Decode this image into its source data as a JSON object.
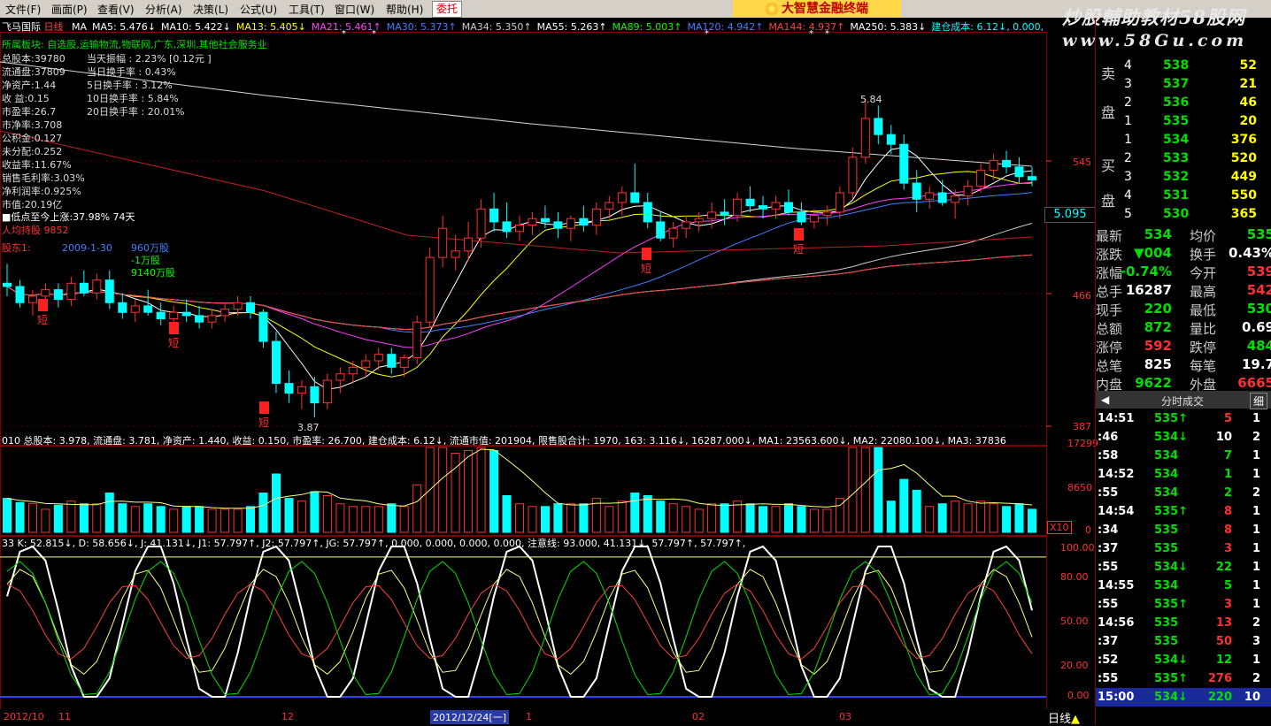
{
  "menu": [
    "文件(F)",
    "画面(P)",
    "查看(V)",
    "分析(A)",
    "决策(L)",
    "公式(U)",
    "工具(T)",
    "窗口(W)",
    "帮助(H)"
  ],
  "trade_button": "委托",
  "banner": "大智慧金融终端",
  "watermark": {
    "line1": "炒股輔助教材58股网",
    "line2": "www.58Gu.com"
  },
  "header": {
    "stock": "飞马国际",
    "period": "日线",
    "ma_items": [
      {
        "label": "MA",
        "color": "#ffffff"
      },
      {
        "label": "MA5: 5.476↓",
        "color": "#ffffff"
      },
      {
        "label": "MA10: 5.422↓",
        "color": "#ffffff"
      },
      {
        "label": "MA13: 5.405↓",
        "color": "#ffff00"
      },
      {
        "label": "MA21: 5.461↑",
        "color": "#ff40ff"
      },
      {
        "label": "MA30: 5.373↑",
        "color": "#4080ff"
      },
      {
        "label": "MA34: 5.350↑",
        "color": "#cccccc"
      },
      {
        "label": "MA55: 5.263↑",
        "color": "#ffffff"
      },
      {
        "label": "MA89: 5.003↑",
        "color": "#00ff00"
      },
      {
        "label": "MA120: 4.942↑",
        "color": "#4080ff"
      },
      {
        "label": "MA144: 4.937↑",
        "color": "#ff4040"
      },
      {
        "label": "MA250: 5.383↓",
        "color": "#ffffff"
      },
      {
        "label": "建仓成本: 6.12↓, 0.000, 0.00",
        "color": "#00ffff"
      }
    ]
  },
  "sector": "所属板块: 自选股,运输物流,物联网,广东,深圳,其他社会服务业",
  "fundamentals": [
    {
      "label": "总股本:",
      "value": "39780"
    },
    {
      "label": "流通盘:",
      "value": "37809"
    },
    {
      "label": "净资产:",
      "value": "1.44"
    },
    {
      "label": "收  益:",
      "value": "0.15"
    },
    {
      "label": "市盈率:",
      "value": "26.7"
    },
    {
      "label": "市净率:",
      "value": "3.708"
    },
    {
      "label": "公积金:",
      "value": "0.127"
    },
    {
      "label": "未分配:",
      "value": "0.252"
    },
    {
      "label": "收益率:",
      "value": "11.67%"
    },
    {
      "label": "销售毛利率:",
      "value": "3.03%"
    },
    {
      "label": "净利润率",
      "value": ":0.925%"
    },
    {
      "label": "市值:",
      "value": "20.19亿"
    }
  ],
  "turnover": [
    "当天振幅   : 2.23% [0.12元 ]",
    "当日换手率 : 0.43%",
    "5日换手率  : 3.12%",
    "10日换手率 : 5.84%",
    "20日换手率 : 20.01%"
  ],
  "low_to_now": "■低点至今上涨:37.98%   74天",
  "holder_text": "人均持股 9852",
  "holders": [
    {
      "date": "2009-1-30",
      "shares": "960万股",
      "color": "#4080ff"
    },
    {
      "date": "",
      "shares": "-1万股",
      "color": "#00ff00"
    },
    {
      "date": "",
      "shares": "9140万股",
      "color": "#00ff00"
    }
  ],
  "holders_tag": "股东1:",
  "price_axis": [
    "545",
    "466",
    "387"
  ],
  "current_price_tag": "5.095",
  "high_label": "5.84",
  "low_label": "3.87",
  "vol_header": "010 总股本: 3.978, 流通盘: 3.781, 净资产: 1.440, 收益: 0.150, 市盈率: 26.700, 建仓成本: 6.12↓, 流通市值: 201904, 限售股合计: 1970, 163: 3.116↓, 16287.000↓, MA1: 23563.600↓, MA2: 22080.100↓, MA3: 37836",
  "vol_axis": [
    "17299",
    "8650",
    "0"
  ],
  "vol_unit": "X10",
  "kdj_header": "33 K: 52.815↓, D: 58.656↓, J: 41.131↓, J1: 57.797↑, J2: 57.797↑, JG: 57.797↑, 0.000, 0.000, 0.000, 0.000, 注意线: 93.000, 41.131↓, 57.797↑, 57.797↑,",
  "kdj_axis": [
    "100.00",
    "80.00",
    "50.00",
    "20.00",
    "0.00"
  ],
  "date_axis": [
    "2012/10",
    "11",
    "12",
    "2012/12/24[一]",
    "1",
    "02",
    "03"
  ],
  "bottom_tag": "日线",
  "signal_labels": [
    "短",
    "短",
    "短",
    "短",
    "短"
  ],
  "order_book": {
    "sell": [
      {
        "n": "4",
        "price": "538",
        "vol": "52"
      },
      {
        "n": "3",
        "price": "537",
        "vol": "21"
      },
      {
        "n": "2",
        "price": "536",
        "vol": "46"
      },
      {
        "n": "1",
        "price": "535",
        "vol": "20"
      }
    ],
    "buy": [
      {
        "n": "1",
        "price": "534",
        "vol": "376"
      },
      {
        "n": "2",
        "price": "533",
        "vol": "520"
      },
      {
        "n": "3",
        "price": "532",
        "vol": "449"
      },
      {
        "n": "4",
        "price": "531",
        "vol": "550"
      },
      {
        "n": "5",
        "price": "530",
        "vol": "365"
      }
    ],
    "sell_label": [
      "卖",
      "盘"
    ],
    "buy_label": [
      "买",
      "盘"
    ]
  },
  "quote": [
    {
      "l1": "最新",
      "v1": "534",
      "c1": "#00e000",
      "l2": "均价",
      "v2": "535",
      "c2": "#00e000"
    },
    {
      "l1": "涨跌",
      "v1": "▼004",
      "c1": "#00e000",
      "l2": "换手",
      "v2": "0.43%",
      "c2": "#ffffff"
    },
    {
      "l1": "涨幅",
      "v1": "-0.74%",
      "c1": "#00e000",
      "l2": "今开",
      "v2": "539",
      "c2": "#ff3030"
    },
    {
      "l1": "总手",
      "v1": "16287",
      "c1": "#ffffff",
      "l2": "最高",
      "v2": "542",
      "c2": "#ff3030"
    },
    {
      "l1": "现手",
      "v1": "220",
      "c1": "#00e000",
      "l2": "最低",
      "v2": "530",
      "c2": "#00e000"
    },
    {
      "l1": "总额",
      "v1": "872",
      "c1": "#00e000",
      "l2": "量比",
      "v2": "0.69",
      "c2": "#ffffff"
    },
    {
      "l1": "涨停",
      "v1": "592",
      "c1": "#ff3030",
      "l2": "跌停",
      "v2": "484",
      "c2": "#00e000"
    },
    {
      "l1": "总笔",
      "v1": "825",
      "c1": "#ffffff",
      "l2": "每笔",
      "v2": "19.7",
      "c2": "#ffffff"
    },
    {
      "l1": "内盘",
      "v1": "9622",
      "c1": "#00e000",
      "l2": "外盘",
      "v2": "6665",
      "c2": "#ff3030"
    }
  ],
  "tick_header": {
    "title": "分时成交",
    "left": "◀",
    "right": "细"
  },
  "ticks": [
    {
      "t": "14:51",
      "p": "535↑",
      "pc": "#00e000",
      "v": "5",
      "vc": "#ff3030",
      "n": "1"
    },
    {
      "t": ":46",
      "p": "534↓",
      "pc": "#00e000",
      "v": "10",
      "vc": "#ffffff",
      "n": "2"
    },
    {
      "t": ":58",
      "p": "534",
      "pc": "#00e000",
      "v": "7",
      "vc": "#00e000",
      "n": "1"
    },
    {
      "t": "14:52",
      "p": "534",
      "pc": "#00e000",
      "v": "1",
      "vc": "#00e000",
      "n": "1"
    },
    {
      "t": ":55",
      "p": "534",
      "pc": "#00e000",
      "v": "2",
      "vc": "#00e000",
      "n": "2"
    },
    {
      "t": "14:54",
      "p": "535↑",
      "pc": "#00e000",
      "v": "8",
      "vc": "#ff3030",
      "n": "1"
    },
    {
      "t": ":34",
      "p": "535",
      "pc": "#00e000",
      "v": "8",
      "vc": "#ff3030",
      "n": "1"
    },
    {
      "t": ":37",
      "p": "535",
      "pc": "#00e000",
      "v": "3",
      "vc": "#ff3030",
      "n": "1"
    },
    {
      "t": ":55",
      "p": "534↓",
      "pc": "#00e000",
      "v": "22",
      "vc": "#00e000",
      "n": "1"
    },
    {
      "t": "14:55",
      "p": "534",
      "pc": "#00e000",
      "v": "5",
      "vc": "#00e000",
      "n": "1"
    },
    {
      "t": ":55",
      "p": "535↑",
      "pc": "#00e000",
      "v": "3",
      "vc": "#ff3030",
      "n": "1"
    },
    {
      "t": "14:56",
      "p": "535",
      "pc": "#00e000",
      "v": "13",
      "vc": "#ff3030",
      "n": "2"
    },
    {
      "t": ":37",
      "p": "535",
      "pc": "#00e000",
      "v": "50",
      "vc": "#ff3030",
      "n": "3"
    },
    {
      "t": ":52",
      "p": "534↓",
      "pc": "#00e000",
      "v": "12",
      "vc": "#00e000",
      "n": "1"
    },
    {
      "t": ":55",
      "p": "535↑",
      "pc": "#00e000",
      "v": "276",
      "vc": "#ff3030",
      "n": "2"
    },
    {
      "t": "15:00",
      "p": "534↓",
      "pc": "#00e000",
      "v": "220",
      "vc": "#00e000",
      "n": "10"
    }
  ],
  "colors": {
    "up": "#ff3030",
    "down": "#00ffff",
    "grid": "#800000",
    "text": "#cccccc"
  },
  "chart_data": {
    "type": "candlestick",
    "price_ticks": [
      5.45,
      4.66,
      3.87
    ],
    "ylim": [
      3.87,
      5.84
    ],
    "candles": [
      [
        4.7,
        4.82,
        4.62,
        4.68
      ],
      [
        4.68,
        4.72,
        4.55,
        4.58
      ],
      [
        4.58,
        4.66,
        4.5,
        4.62
      ],
      [
        4.62,
        4.7,
        4.58,
        4.66
      ],
      [
        4.66,
        4.7,
        4.55,
        4.6
      ],
      [
        4.6,
        4.74,
        4.56,
        4.7
      ],
      [
        4.7,
        4.78,
        4.62,
        4.64
      ],
      [
        4.64,
        4.76,
        4.6,
        4.72
      ],
      [
        4.72,
        4.78,
        4.54,
        4.58
      ],
      [
        4.58,
        4.64,
        4.48,
        4.52
      ],
      [
        4.52,
        4.6,
        4.46,
        4.56
      ],
      [
        4.56,
        4.66,
        4.5,
        4.52
      ],
      [
        4.52,
        4.58,
        4.44,
        4.48
      ],
      [
        4.48,
        4.56,
        4.44,
        4.52
      ],
      [
        4.52,
        4.6,
        4.46,
        4.5
      ],
      [
        4.5,
        4.56,
        4.42,
        4.46
      ],
      [
        4.46,
        4.54,
        4.42,
        4.5
      ],
      [
        4.5,
        4.58,
        4.46,
        4.54
      ],
      [
        4.54,
        4.62,
        4.5,
        4.58
      ],
      [
        4.58,
        4.62,
        4.48,
        4.52
      ],
      [
        4.52,
        4.54,
        4.3,
        4.34
      ],
      [
        4.34,
        4.4,
        4.02,
        4.08
      ],
      [
        4.08,
        4.16,
        3.96,
        4.02
      ],
      [
        4.02,
        4.1,
        3.92,
        4.06
      ],
      [
        4.06,
        4.12,
        3.87,
        3.96
      ],
      [
        3.96,
        4.14,
        3.92,
        4.1
      ],
      [
        4.1,
        4.18,
        4.02,
        4.14
      ],
      [
        4.14,
        4.22,
        4.08,
        4.18
      ],
      [
        4.18,
        4.26,
        4.12,
        4.22
      ],
      [
        4.22,
        4.3,
        4.16,
        4.26
      ],
      [
        4.26,
        4.3,
        4.14,
        4.18
      ],
      [
        4.18,
        4.26,
        4.12,
        4.24
      ],
      [
        4.24,
        4.5,
        4.2,
        4.46
      ],
      [
        4.46,
        4.92,
        4.42,
        4.86
      ],
      [
        4.86,
        5.12,
        4.8,
        5.04
      ],
      [
        4.86,
        5.0,
        4.78,
        4.9
      ],
      [
        4.9,
        5.08,
        4.84,
        4.98
      ],
      [
        4.98,
        5.22,
        4.92,
        5.16
      ],
      [
        5.16,
        5.26,
        5.02,
        5.08
      ],
      [
        5.08,
        5.2,
        4.98,
        5.02
      ],
      [
        5.02,
        5.12,
        4.96,
        5.06
      ],
      [
        5.06,
        5.14,
        5.0,
        5.1
      ],
      [
        5.1,
        5.18,
        5.04,
        5.08
      ],
      [
        5.08,
        5.14,
        4.98,
        5.04
      ],
      [
        5.04,
        5.12,
        4.96,
        5.1
      ],
      [
        5.1,
        5.18,
        5.02,
        5.06
      ],
      [
        5.06,
        5.2,
        5.0,
        5.16
      ],
      [
        5.16,
        5.24,
        5.1,
        5.2
      ],
      [
        5.2,
        5.3,
        5.12,
        5.26
      ],
      [
        5.26,
        5.44,
        5.2,
        5.2
      ],
      [
        5.2,
        5.26,
        5.04,
        5.08
      ],
      [
        5.08,
        5.14,
        4.96,
        4.98
      ],
      [
        4.98,
        5.08,
        4.92,
        5.04
      ],
      [
        5.04,
        5.12,
        4.98,
        5.08
      ],
      [
        5.08,
        5.14,
        5.02,
        5.1
      ],
      [
        5.1,
        5.2,
        5.04,
        5.14
      ],
      [
        5.14,
        5.22,
        5.06,
        5.12
      ],
      [
        5.12,
        5.26,
        5.08,
        5.22
      ],
      [
        5.22,
        5.3,
        5.14,
        5.18
      ],
      [
        5.18,
        5.24,
        5.1,
        5.16
      ],
      [
        5.16,
        5.24,
        5.1,
        5.2
      ],
      [
        5.2,
        5.28,
        5.12,
        5.14
      ],
      [
        5.14,
        5.2,
        5.06,
        5.08
      ],
      [
        5.08,
        5.16,
        5.04,
        5.12
      ],
      [
        5.12,
        5.18,
        5.06,
        5.14
      ],
      [
        5.14,
        5.3,
        5.1,
        5.26
      ],
      [
        5.26,
        5.54,
        5.22,
        5.48
      ],
      [
        5.48,
        5.84,
        5.44,
        5.72
      ],
      [
        5.72,
        5.8,
        5.56,
        5.62
      ],
      [
        5.62,
        5.68,
        5.5,
        5.56
      ],
      [
        5.56,
        5.62,
        5.28,
        5.32
      ],
      [
        5.32,
        5.4,
        5.14,
        5.22
      ],
      [
        5.22,
        5.3,
        5.16,
        5.26
      ],
      [
        5.26,
        5.34,
        5.18,
        5.2
      ],
      [
        5.2,
        5.28,
        5.1,
        5.24
      ],
      [
        5.24,
        5.34,
        5.18,
        5.3
      ],
      [
        5.3,
        5.44,
        5.26,
        5.4
      ],
      [
        5.4,
        5.5,
        5.34,
        5.46
      ],
      [
        5.46,
        5.52,
        5.38,
        5.42
      ],
      [
        5.42,
        5.48,
        5.32,
        5.36
      ],
      [
        5.36,
        5.42,
        5.3,
        5.34
      ]
    ],
    "kdj_ylim": [
      0,
      100
    ]
  }
}
